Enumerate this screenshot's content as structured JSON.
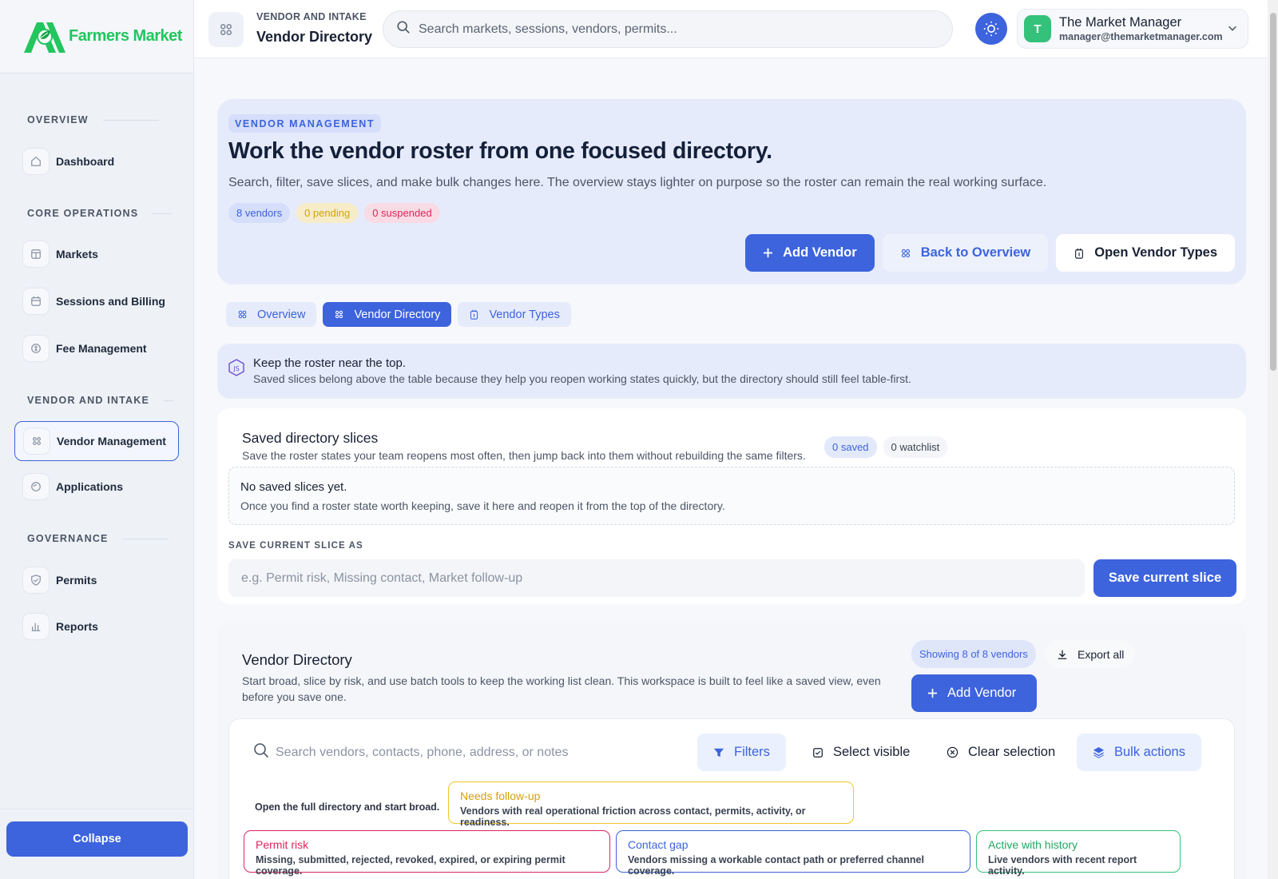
{
  "brand": {
    "name": "Farmers Market"
  },
  "sidebar": {
    "sections": [
      {
        "heading": "OVERVIEW"
      },
      {
        "heading": "CORE OPERATIONS"
      },
      {
        "heading": "VENDOR AND INTAKE"
      },
      {
        "heading": "GOVERNANCE"
      }
    ],
    "items": [
      {
        "label": "Dashboard",
        "icon": "home-icon"
      },
      {
        "label": "Markets",
        "icon": "storefront-icon"
      },
      {
        "label": "Sessions and Billing",
        "icon": "calendar-icon"
      },
      {
        "label": "Fee Management",
        "icon": "coin-icon"
      },
      {
        "label": "Vendor Management",
        "icon": "vendors-icon",
        "active": true
      },
      {
        "label": "Applications",
        "icon": "application-icon"
      },
      {
        "label": "Permits",
        "icon": "shield-check-icon"
      },
      {
        "label": "Reports",
        "icon": "bar-chart-icon"
      }
    ],
    "collapse_label": "Collapse"
  },
  "topbar": {
    "crumb": "VENDOR AND INTAKE",
    "title": "Vendor Directory",
    "search_placeholder": "Search markets, sessions, vendors, permits...",
    "user": {
      "initial": "T",
      "name": "The Market Manager",
      "email": "manager@themarketmanager.com"
    }
  },
  "hero": {
    "tag": "VENDOR MANAGEMENT",
    "title": "Work the vendor roster from one focused directory.",
    "subtitle": "Search, filter, save slices, and make bulk changes here. The overview stays lighter on purpose so the roster can remain the real working surface.",
    "chips": {
      "vendors": "8 vendors",
      "pending": "0 pending",
      "suspended": "0 suspended"
    },
    "actions": {
      "add": "Add Vendor",
      "back": "Back to Overview",
      "types": "Open Vendor Types"
    }
  },
  "tabs": [
    {
      "label": "Overview"
    },
    {
      "label": "Vendor Directory",
      "active": true
    },
    {
      "label": "Vendor Types"
    }
  ],
  "callout": {
    "title": "Keep the roster near the top.",
    "body": "Saved slices belong above the table because they help you reopen working states quickly, but the directory should still feel table-first."
  },
  "slices": {
    "title": "Saved directory slices",
    "subtitle": "Save the roster states your team reopens most often, then jump back into them without rebuilding the same filters.",
    "saved_chip": "0 saved",
    "watch_chip": "0 watchlist",
    "empty_title": "No saved slices yet.",
    "empty_body": "Once you find a roster state worth keeping, save it here and reopen it from the top of the directory.",
    "save_label": "SAVE CURRENT SLICE AS",
    "save_placeholder": "e.g. Permit risk, Missing contact, Market follow-up",
    "save_button": "Save current slice"
  },
  "directory": {
    "title": "Vendor Directory",
    "subtitle": "Start broad, slice by risk, and use batch tools to keep the working list clean. This workspace is built to feel like a saved view, even before you save one.",
    "showing": "Showing 8 of 8 vendors",
    "export": "Export all",
    "add": "Add Vendor",
    "search_placeholder": "Search vendors, contacts, phone, address, or notes",
    "tools": {
      "filters": "Filters",
      "select_visible": "Select visible",
      "clear": "Clear selection",
      "bulk": "Bulk actions"
    },
    "preset_note": "Open the full directory and start broad.",
    "presets": [
      {
        "title": "Needs follow-up",
        "desc": "Vendors with real operational friction across contact, permits, activity, or readiness.",
        "color": "#f0c62a"
      },
      {
        "title": "Permit risk",
        "desc": "Missing, submitted, rejected, revoked, expired, or expiring permit coverage.",
        "color": "#e0245e"
      },
      {
        "title": "Contact gap",
        "desc": "Vendors missing a workable contact path or preferred channel coverage.",
        "color": "#3d63dd"
      },
      {
        "title": "Active with history",
        "desc": "Live vendors with recent report activity.",
        "color": "#34c27b"
      }
    ]
  },
  "colors": {
    "accent": "#3d63dd",
    "brand": "#22c55e",
    "warning": "#d3a20a",
    "danger": "#e0245e",
    "success": "#34c27b"
  }
}
